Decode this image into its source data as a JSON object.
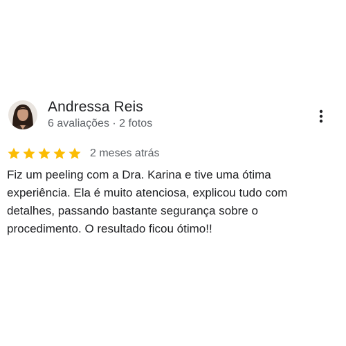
{
  "reviewer": {
    "name": "Andressa Reis",
    "meta": "6 avaliações · 2 fotos"
  },
  "rating": {
    "stars": 5,
    "max": 5,
    "star_color": "#fbbc04",
    "date": "2 meses atrás"
  },
  "review": {
    "text": "Fiz um peeling com a Dra. Karina e tive uma ótima experiência. Ela é muito atenciosa, explicou tudo com detalhes, passando bastante segurança sobre o procedimento. O resultado ficou ótimo!!"
  },
  "icons": {
    "menu": "more-vert-icon",
    "star": "star-icon"
  }
}
